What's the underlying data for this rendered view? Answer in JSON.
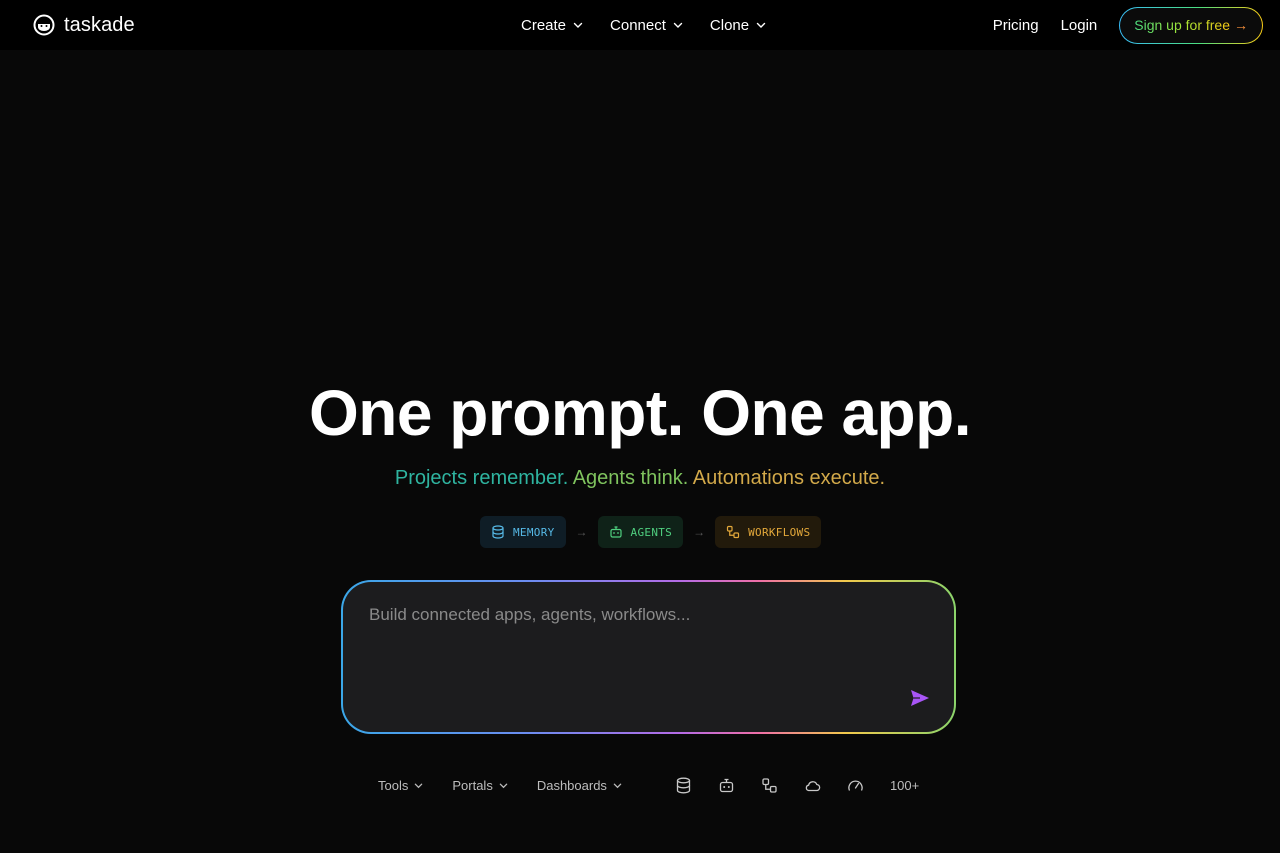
{
  "header": {
    "logo_text": "taskade",
    "nav": [
      {
        "label": "Create",
        "icon": "chevron-down-icon"
      },
      {
        "label": "Connect",
        "icon": "chevron-down-icon"
      },
      {
        "label": "Clone",
        "icon": "chevron-down-icon"
      }
    ],
    "pricing_label": "Pricing",
    "login_label": "Login",
    "signup_label": "Sign up for free",
    "signup_arrow": "→"
  },
  "hero": {
    "title": "One prompt. One app.",
    "subtitle_parts": [
      "Projects remember.",
      "Agents think.",
      "Automations execute."
    ],
    "subtitle_colors": [
      "#2fb4a0",
      "#7fc35e",
      "#d2a94a"
    ]
  },
  "pills": [
    {
      "label": "MEMORY",
      "icon": "database-icon",
      "color": "#56b9e6"
    },
    {
      "label": "AGENTS",
      "icon": "robot-icon",
      "color": "#4fcf7f"
    },
    {
      "label": "WORKFLOWS",
      "icon": "workflow-icon",
      "color": "#e3a83a"
    }
  ],
  "pill_separator": "→",
  "prompt": {
    "placeholder": "Build connected apps, agents, workflows...",
    "value": "",
    "send_icon": "send-icon",
    "send_color": "#a855f7"
  },
  "toolbar": {
    "dropdowns": [
      {
        "label": "Tools"
      },
      {
        "label": "Portals"
      },
      {
        "label": "Dashboards"
      }
    ],
    "icons": [
      "database-icon",
      "robot-icon",
      "workflow-icon",
      "cloud-icon",
      "gauge-icon"
    ],
    "more_label": "100+"
  }
}
